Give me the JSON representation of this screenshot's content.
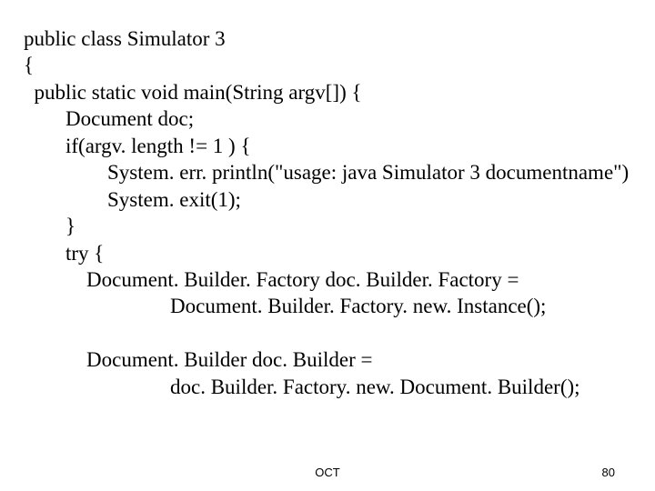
{
  "code": {
    "l1": "public class Simulator 3",
    "l2": "{",
    "l3": "  public static void main(String argv[]) {",
    "l4": "        Document doc;",
    "l5": "        if(argv. length != 1 ) {",
    "l6": "                System. err. println(\"usage: java Simulator 3 documentname\")",
    "l7": "                System. exit(1);",
    "l8": "        }",
    "l9": "        try {",
    "l10": "            Document. Builder. Factory doc. Builder. Factory =",
    "l11": "                            Document. Builder. Factory. new. Instance();",
    "l12": "",
    "l13": "            Document. Builder doc. Builder =",
    "l14": "                            doc. Builder. Factory. new. Document. Builder();"
  },
  "footer": {
    "center": "OCT",
    "page": "80"
  }
}
